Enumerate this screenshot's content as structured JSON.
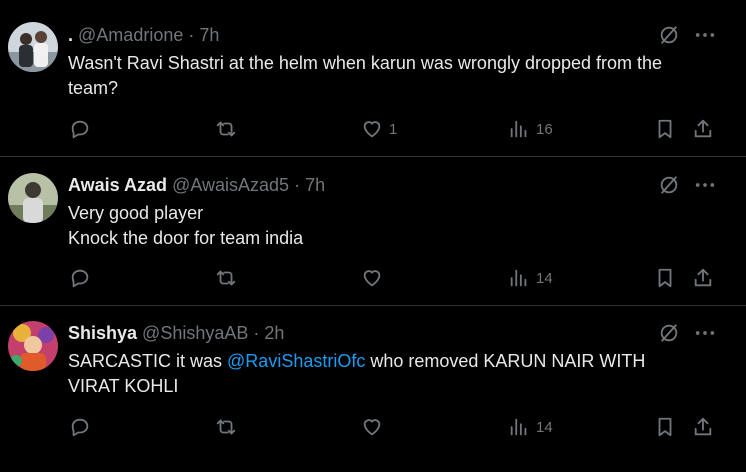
{
  "tweets": [
    {
      "name": ".",
      "handle": "@Amadrione",
      "sep": "·",
      "time": "7h",
      "text_lines": [
        "Wasn't Ravi Shastri at the helm when karun was wrongly dropped from the",
        "team?"
      ],
      "replies": "",
      "reposts": "",
      "likes": "1",
      "views": "16",
      "avatar_colors": [
        "#cfd6dd",
        "#2b2f33"
      ]
    },
    {
      "name": "Awais Azad",
      "handle": "@AwaisAzad5",
      "sep": "·",
      "time": "7h",
      "text_lines": [
        "Very good player",
        "Knock the door for team india"
      ],
      "replies": "",
      "reposts": "",
      "likes": "",
      "views": "14",
      "avatar_colors": [
        "#9aa888",
        "#3d3a33"
      ]
    },
    {
      "name": "Shishya",
      "handle": "@ShishyaAB",
      "sep": "·",
      "time": "2h",
      "text_prefix": "SARCASTIC it was ",
      "mention": "@RaviShastriOfc",
      "text_suffix": " who removed KARUN NAIR WITH",
      "text_line2": "VIRAT KOHLI",
      "replies": "",
      "reposts": "",
      "likes": "",
      "views": "14",
      "avatar_colors": [
        "#d94f7a",
        "#e8b23a"
      ]
    }
  ],
  "icons": {
    "reply": "reply-icon",
    "repost": "repost-icon",
    "like": "heart-icon",
    "views": "views-icon",
    "bookmark": "bookmark-icon",
    "share": "share-icon",
    "grok": "grok-icon",
    "more": "more-icon"
  },
  "colors": {
    "background": "#000000",
    "text": "#e7e9ea",
    "muted": "#71767b",
    "link": "#1d9bf0",
    "divider": "#2f3336"
  }
}
